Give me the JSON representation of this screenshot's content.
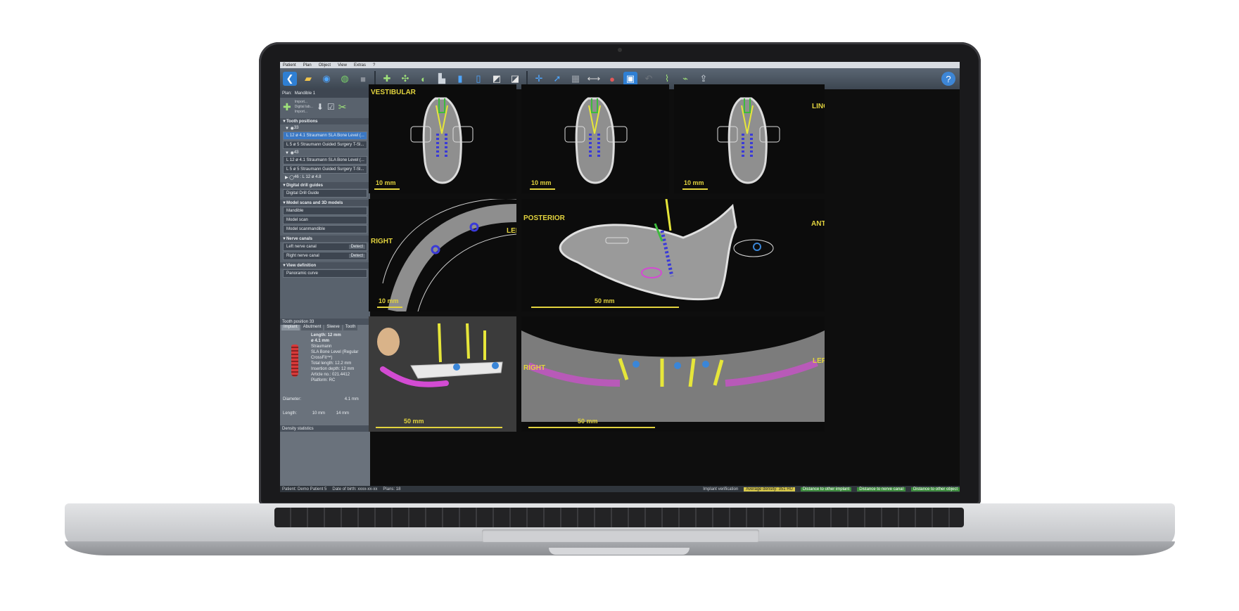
{
  "menu": [
    "Patient",
    "Plan",
    "Object",
    "View",
    "Extras",
    "?"
  ],
  "sidebar": {
    "plan_label": "Plan:",
    "plan_name": "Mandible 1",
    "import_items": [
      "Import...",
      "Digital lab...",
      "Import..."
    ],
    "tooth_positions_title": "Tooth positions",
    "tooth_groups": [
      {
        "tooth": "33",
        "rows": [
          "L 12  ø 4.1   Straumann SLA Bone Level (...",
          "L 5  ø 5   Straumann Guided Surgery T-Sl..."
        ]
      },
      {
        "tooth": "43",
        "rows": [
          "L 12  ø 4.1   Straumann SLA Bone Level (...",
          "L 5  ø 5   Straumann Guided Surgery T-Sl..."
        ]
      }
    ],
    "tooth_extra": "46 : L 12  ø 4.8",
    "drill_guides_title": "Digital drill guides",
    "drill_guide_item": "Digital Drill Guide",
    "models_title": "Model scans and 3D models",
    "model_items": [
      "Mandible",
      "Model scan",
      "Model scanmandible"
    ],
    "nerve_title": "Nerve canals",
    "nerve_items": [
      {
        "label": "Left nerve canal",
        "action": "Detect"
      },
      {
        "label": "Right nerve canal",
        "action": "Detect"
      }
    ],
    "view_def_title": "View definition",
    "view_def_item": "Panoramic curve"
  },
  "props": {
    "title": "Tooth position 33",
    "tabs": [
      "Implant",
      "Abutment",
      "Sleeve",
      "Tooth"
    ],
    "length_label": "Length: 12 mm",
    "diameter_label": "ø 4.1 mm",
    "lines": [
      "Straumann",
      "SLA Bone Level (Regular CrossFit™)",
      "Total length: 12.2 mm",
      "Insertion depth: 12 mm",
      "Article no.: 021.4412",
      "Platform: RC"
    ],
    "diameter_row": "Diameter:",
    "diameter_value": "4.1 mm",
    "length_row": "Length:",
    "length_values": [
      "10 mm",
      "14 mm"
    ],
    "density": "Density statistics"
  },
  "status": {
    "patient": "Patient: Demo Patient 5",
    "dob": "Date of birth: xxxx-xx-xx",
    "plans": "Plans: 18",
    "implant_verif": "Implant verification",
    "avg_density": "Average density: 351 HU",
    "dist_implant": "Distance to other implant",
    "dist_nerve": "Distance to nerve canal",
    "dist_object": "Distance to other object"
  },
  "views": {
    "vestibular": "VESTIBULAR",
    "lingual": "LINGUAL",
    "right": "RIGHT",
    "left": "LEFT",
    "posterior": "POSTERIOR",
    "anterior": "ANTERIOR",
    "right2": "RIGHT",
    "left2": "LEFT",
    "scale_10": "10 mm",
    "scale_50": "50 mm"
  },
  "colors": {
    "orientation_text": "#e2d33e",
    "implant_green": "#3dbb3d",
    "implant_yellow": "#e6e63a",
    "canal_blue": "#3a3ad8",
    "nerve_magenta": "#d24bd2"
  }
}
